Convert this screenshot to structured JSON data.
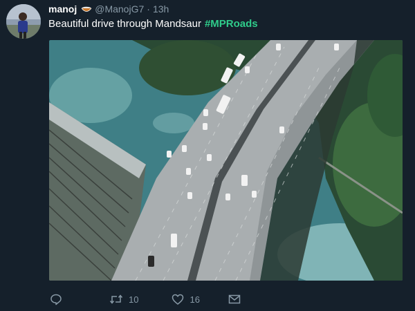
{
  "tweet": {
    "name": "manoj",
    "handle": "@ManojG7",
    "dot": "·",
    "time": "13h",
    "text": "Beautiful drive through Mandsaur",
    "hashtag": "#MPRoads",
    "badge_icon": "bowl-emoji-icon",
    "avatar_icon": "user-avatar"
  },
  "media": {
    "description_icon": "highway-bridge-photo"
  },
  "actions": {
    "reply_icon": "reply-icon",
    "retweet_icon": "retweet-icon",
    "retweet_count": "10",
    "like_icon": "heart-icon",
    "like_count": "16",
    "dm_icon": "envelope-icon"
  },
  "colors": {
    "background": "#15202b",
    "text": "#ffffff",
    "muted": "#8899a6",
    "hashtag": "#2fcc8b"
  }
}
